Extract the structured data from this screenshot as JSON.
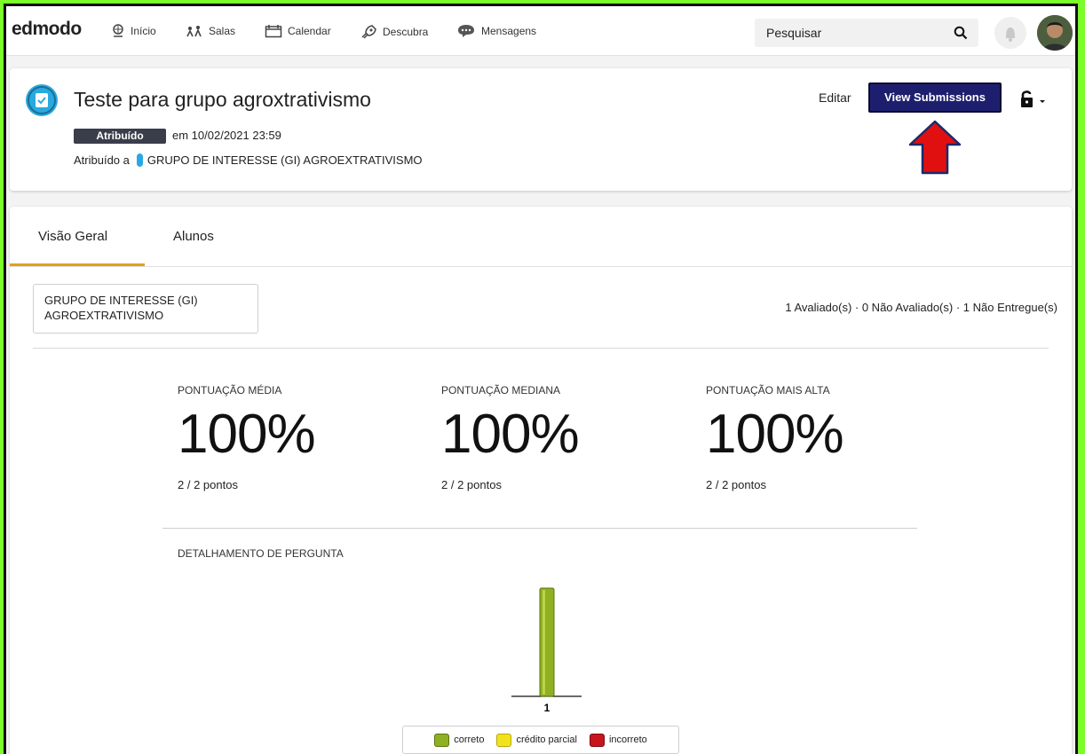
{
  "nav": {
    "logo": "edmodo",
    "items": [
      {
        "label": "Início",
        "icon": "home-icon"
      },
      {
        "label": "Salas",
        "icon": "rooms-icon"
      },
      {
        "label": "Calendar",
        "icon": "calendar-icon"
      },
      {
        "label": "Descubra",
        "icon": "discover-icon"
      },
      {
        "label": "Mensagens",
        "icon": "messages-icon"
      }
    ],
    "search_placeholder": "Pesquisar"
  },
  "assignment": {
    "title": "Teste para grupo agroxtrativismo",
    "status_badge": "Atribuído",
    "due": "em 10/02/2021 23:59",
    "assigned_to_label": "Atribuído a",
    "assigned_to_group": "GRUPO DE INTERESSE (GI) AGROEXTRATIVISMO",
    "edit_label": "Editar",
    "view_submissions_label": "View Submissions"
  },
  "tabs": [
    {
      "label": "Visão Geral",
      "active": true
    },
    {
      "label": "Alunos",
      "active": false
    }
  ],
  "overview": {
    "group_selector": "GRUPO DE INTERESSE (GI) AGROEXTRATIVISMO",
    "counts": "1 Avaliado(s) · 0 Não Avaliado(s) · 1 Não Entregue(s)",
    "stats": [
      {
        "label": "PONTUAÇÃO MÉDIA",
        "value": "100%",
        "points": "2 / 2 pontos"
      },
      {
        "label": "PONTUAÇÃO MEDIANA",
        "value": "100%",
        "points": "2 / 2 pontos"
      },
      {
        "label": "PONTUAÇÃO MAIS ALTA",
        "value": "100%",
        "points": "2 / 2 pontos"
      }
    ],
    "breakdown_title": "DETALHAMENTO DE PERGUNTA",
    "legend": [
      {
        "label": "correto",
        "color": "#8fb021"
      },
      {
        "label": "crédito parcial",
        "color": "#f2e21a"
      },
      {
        "label": "incorreto",
        "color": "#c8141c"
      }
    ]
  },
  "chart_data": {
    "type": "bar",
    "categories": [
      "1"
    ],
    "series": [
      {
        "name": "correto",
        "values": [
          1
        ]
      },
      {
        "name": "crédito parcial",
        "values": [
          0
        ]
      },
      {
        "name": "incorreto",
        "values": [
          0
        ]
      }
    ],
    "title": "DETALHAMENTO DE PERGUNTA",
    "legend": "bottom"
  },
  "colors": {
    "accent_tab": "#e0a11b",
    "button_bg": "#1d1f6e",
    "arrow": "#e01010",
    "badge_bg": "#3a3d4a"
  }
}
